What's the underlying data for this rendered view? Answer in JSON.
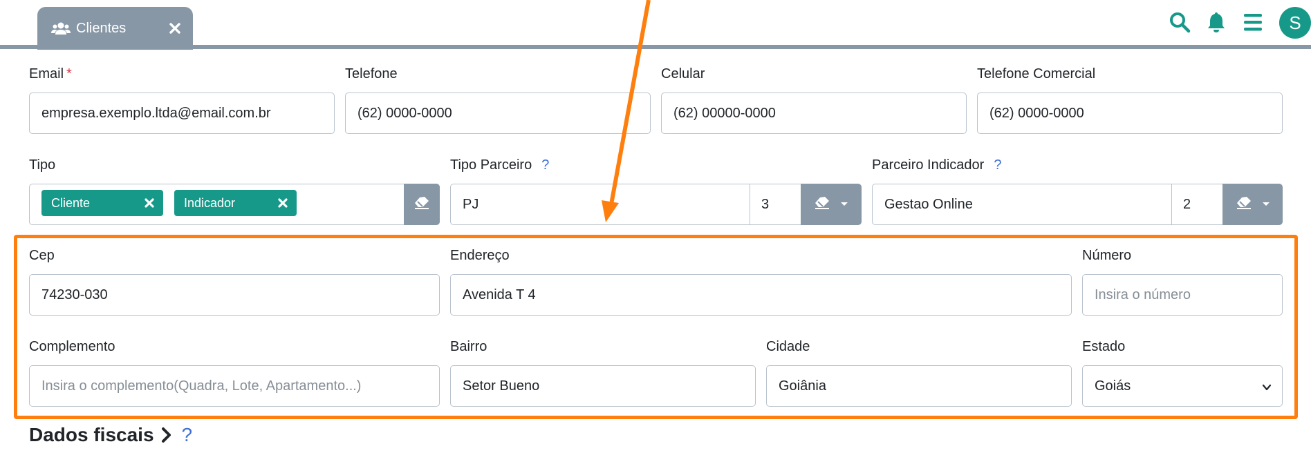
{
  "header": {
    "tab": {
      "label": "Clientes",
      "icon": "users-icon",
      "close_icon": "close-icon"
    },
    "icons": [
      "search-icon",
      "bell-icon",
      "menu-icon"
    ],
    "avatar": "S",
    "accent": "#17998a",
    "tab_color": "#8797a6"
  },
  "form": {
    "email": {
      "label": "Email",
      "required_mark": "*",
      "value": "empresa.exemplo.ltda@email.com.br"
    },
    "telefone": {
      "label": "Telefone",
      "value": "(62) 0000-0000"
    },
    "celular": {
      "label": "Celular",
      "value": "(62) 00000-0000"
    },
    "telefone_comercial": {
      "label": "Telefone Comercial",
      "value": "(62) 0000-0000"
    },
    "tipo": {
      "label": "Tipo",
      "chips": [
        "Cliente",
        "Indicador"
      ]
    },
    "tipo_parceiro": {
      "label": "Tipo Parceiro",
      "help": "?",
      "value": "PJ",
      "number": "3"
    },
    "parceiro_indicador": {
      "label": "Parceiro Indicador",
      "help": "?",
      "value": "Gestao Online",
      "number": "2"
    },
    "cep": {
      "label": "Cep",
      "value": "74230-030"
    },
    "endereco": {
      "label": "Endereço",
      "value": "Avenida T 4"
    },
    "numero": {
      "label": "Número",
      "placeholder": "Insira o número"
    },
    "complemento": {
      "label": "Complemento",
      "placeholder": "Insira o complemento(Quadra, Lote, Apartamento...)"
    },
    "bairro": {
      "label": "Bairro",
      "value": "Setor Bueno"
    },
    "cidade": {
      "label": "Cidade",
      "value": "Goiânia"
    },
    "estado": {
      "label": "Estado",
      "value": "Goiás"
    }
  },
  "section": {
    "title": "Dados fiscais",
    "help": "?"
  },
  "annotation": {
    "color": "#ff7f0e"
  }
}
